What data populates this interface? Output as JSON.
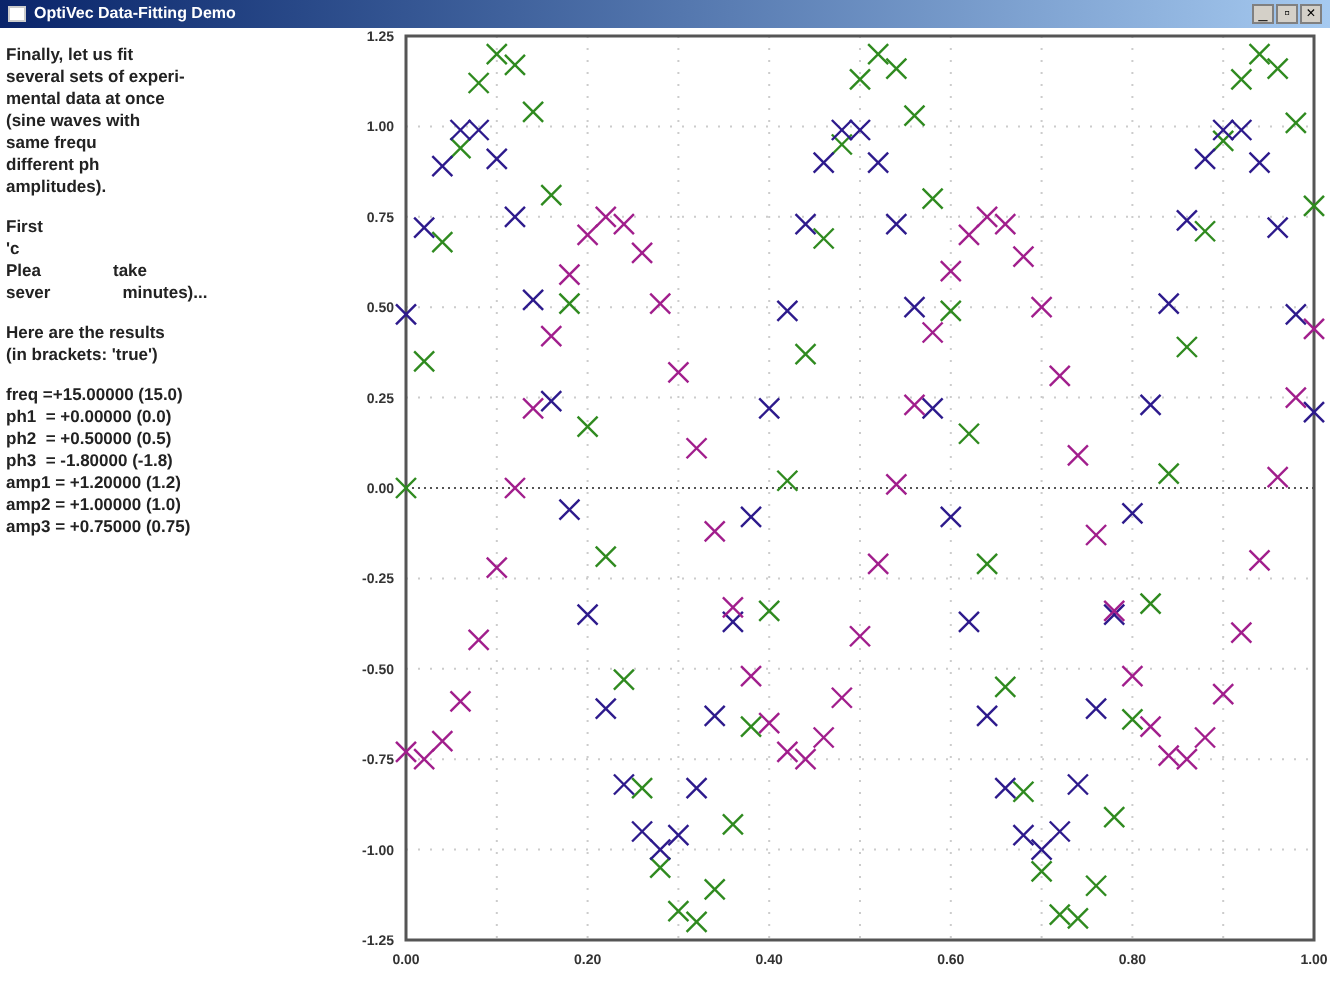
{
  "window": {
    "title": "OptiVec Data-Fitting Demo",
    "controls": [
      "_",
      "▫",
      "×"
    ]
  },
  "text_panel": {
    "paragraphs": [
      [
        [
          "Finally, let us fit"
        ],
        [
          "several sets of experi-"
        ],
        [
          "mental data at once"
        ],
        [
          "(sine waves with"
        ],
        [
          "same frequ"
        ],
        [
          "different ph"
        ],
        [
          "amplitudes)."
        ]
      ],
      [
        [
          "First"
        ],
        [
          "'c"
        ],
        [
          "Plea",
          "take"
        ],
        [
          "sever",
          "minutes)..."
        ]
      ],
      [
        [
          "Here are the results"
        ],
        [
          "(in brackets: 'true')"
        ]
      ],
      [
        [
          "freq =+15.00000 (15.0)"
        ],
        [
          "ph1  = +0.00000 (0.0)"
        ],
        [
          "ph2  = +0.50000 (0.5)"
        ],
        [
          "ph3  = -1.80000 (-1.8)"
        ],
        [
          "amp1 = +1.20000 (1.2)"
        ],
        [
          "amp2 = +1.00000 (1.0)"
        ],
        [
          "amp3 = +0.75000 (0.75)"
        ]
      ]
    ]
  },
  "chart": {
    "chart_data": {
      "type": "scatter",
      "grid": true,
      "ref_lines": [
        {
          "axis": "y",
          "value": 0
        }
      ],
      "xlim": [
        0,
        1
      ],
      "ylim": [
        -1.25,
        1.25
      ],
      "xticks": [
        {
          "value": 0,
          "label": "0.00"
        },
        {
          "value": 0.2,
          "label": "0.20"
        },
        {
          "value": 0.4,
          "label": "0.40"
        },
        {
          "value": 0.6,
          "label": "0.60"
        },
        {
          "value": 0.8,
          "label": "0.80"
        },
        {
          "value": 1,
          "label": "1.00"
        }
      ],
      "yticks": [
        {
          "value": 1.25,
          "label": "1.25"
        },
        {
          "value": 1,
          "label": "1.00"
        },
        {
          "value": 0.75,
          "label": "0.75"
        },
        {
          "value": 0.5,
          "label": "0.50"
        },
        {
          "value": 0.25,
          "label": "0.25"
        },
        {
          "value": 0,
          "label": "0.00"
        },
        {
          "value": -0.25,
          "label": "-0.25"
        },
        {
          "value": -0.5,
          "label": "-0.50"
        },
        {
          "value": -0.75,
          "label": "-0.75"
        },
        {
          "value": -1,
          "label": "-1.00"
        },
        {
          "value": -1.25,
          "label": "-1.25"
        }
      ],
      "x": [
        0,
        0.02,
        0.04,
        0.06,
        0.08,
        0.1,
        0.12,
        0.14,
        0.16,
        0.18,
        0.2,
        0.22,
        0.24,
        0.26,
        0.28,
        0.3,
        0.32,
        0.34,
        0.36,
        0.38,
        0.4,
        0.42,
        0.44,
        0.46,
        0.48,
        0.5,
        0.52,
        0.54,
        0.56,
        0.58,
        0.6,
        0.62,
        0.64,
        0.66,
        0.68,
        0.7,
        0.72,
        0.74,
        0.76,
        0.78,
        0.8,
        0.82,
        0.84,
        0.86,
        0.88,
        0.9,
        0.92,
        0.94,
        0.96,
        0.98,
        1
      ],
      "series": [
        {
          "color": "#2f8a1f",
          "values": [
            0,
            0.35,
            0.68,
            0.94,
            1.12,
            1.2,
            1.17,
            1.04,
            0.81,
            0.51,
            0.17,
            -0.19,
            -0.53,
            -0.83,
            -1.05,
            -1.17,
            -1.2,
            -1.11,
            -0.93,
            -0.66,
            -0.34,
            0.02,
            0.37,
            0.69,
            0.95,
            1.13,
            1.2,
            1.16,
            1.03,
            0.8,
            0.49,
            0.15,
            -0.21,
            -0.55,
            -0.84,
            -1.06,
            -1.18,
            -1.19,
            -1.1,
            -0.91,
            -0.64,
            -0.32,
            0.04,
            0.39,
            0.71,
            0.96,
            1.13,
            1.2,
            1.16,
            1.01,
            0.78
          ]
        },
        {
          "color": "#2d1a8c",
          "values": [
            0.48,
            0.72,
            0.89,
            0.99,
            0.99,
            0.91,
            0.75,
            0.52,
            0.24,
            -0.06,
            -0.35,
            -0.61,
            -0.82,
            -0.95,
            -1,
            -0.96,
            -0.83,
            -0.63,
            -0.37,
            -0.08,
            0.22,
            0.49,
            0.73,
            0.9,
            0.99,
            0.99,
            0.9,
            0.73,
            0.5,
            0.22,
            -0.08,
            -0.37,
            -0.63,
            -0.83,
            -0.96,
            -1,
            -0.95,
            -0.82,
            -0.61,
            -0.35,
            -0.07,
            0.23,
            0.51,
            0.74,
            0.91,
            0.99,
            0.99,
            0.9,
            0.72,
            0.48,
            0.21
          ]
        },
        {
          "color": "#a11e8c",
          "values": [
            -0.73,
            -0.75,
            -0.7,
            -0.59,
            -0.42,
            -0.22,
            0,
            0.22,
            0.42,
            0.59,
            0.7,
            0.75,
            0.73,
            0.65,
            0.51,
            0.32,
            0.11,
            -0.12,
            -0.33,
            -0.52,
            -0.65,
            -0.73,
            -0.75,
            -0.69,
            -0.58,
            -0.41,
            -0.21,
            0.01,
            0.23,
            0.43,
            0.6,
            0.7,
            0.75,
            0.73,
            0.64,
            0.5,
            0.31,
            0.09,
            -0.13,
            -0.34,
            -0.52,
            -0.66,
            -0.74,
            -0.75,
            -0.69,
            -0.57,
            -0.4,
            -0.2,
            0.03,
            0.25,
            0.44
          ]
        }
      ]
    }
  }
}
